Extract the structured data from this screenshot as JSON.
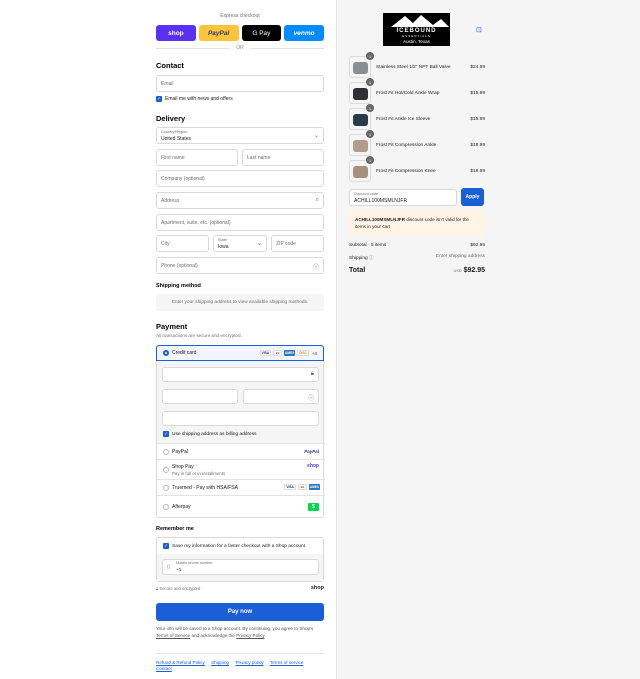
{
  "express": {
    "title": "Express checkout",
    "shop": "shop",
    "paypal": "PayPal",
    "gpay": "G Pay",
    "venmo": "venmo",
    "or": "OR"
  },
  "contact": {
    "heading": "Contact",
    "email_placeholder": "Email",
    "news_label": "Email me with news and offers"
  },
  "delivery": {
    "heading": "Delivery",
    "country_label": "Country/Region",
    "country_value": "United States",
    "first_name": "First name",
    "last_name": "Last name",
    "company": "Company (optional)",
    "address": "Address",
    "apartment": "Apartment, suite, etc. (optional)",
    "city": "City",
    "state_label": "State",
    "state_value": "Iowa",
    "zip": "ZIP code",
    "phone": "Phone (optional)"
  },
  "shipping_method": {
    "heading": "Shipping method",
    "note": "Enter your shipping address to view available shipping methods."
  },
  "payment": {
    "heading": "Payment",
    "subtitle": "All transactions are secure and encrypted.",
    "credit_card": "Credit card",
    "card_more": "+4",
    "billing_same": "Use shipping address as billing address",
    "paypal": "PayPal",
    "shoppay": "Shop Pay",
    "shoppay_sub": "Pay in full or in installments",
    "truemed": "Truemed - Pay with HSA/FSA",
    "afterpay": "Afterpay",
    "card_logos": [
      "VISA",
      "MC",
      "AMEX",
      "DISC"
    ]
  },
  "remember": {
    "heading": "Remember me",
    "save_info": "Save my information for a faster checkout with a Shop account",
    "mobile_label": "Mobile phone number",
    "mobile_value": "+1",
    "secure": "Secure and encrypted",
    "shop": "shop"
  },
  "pay_now": "Pay now",
  "legal": {
    "text1": "Your info will be saved to a Shop account. By continuing, you agree to Shop's ",
    "terms": "Terms of Service",
    "text2": " and acknowledge the ",
    "privacy": "Privacy Policy",
    "text3": "."
  },
  "footer": [
    "Refund & Refund Policy",
    "Shipping",
    "Privacy policy",
    "Terms of service",
    "Contact"
  ],
  "brand": {
    "name": "ICEBOUND",
    "sub": "ESSENTIALS",
    "location": "Austin, Texas"
  },
  "items": [
    {
      "name": "Stainless Steel 1/2\" NPT Ball Valve",
      "price": "$24.99",
      "qty": "1",
      "color": "#8a8f96"
    },
    {
      "name": "Frost Fit Hot/Cold Ankle Wrap",
      "price": "$15.99",
      "qty": "1",
      "color": "#2f2f33"
    },
    {
      "name": "Frost Fit Ankle Ice Sleeve",
      "price": "$15.99",
      "qty": "1",
      "color": "#2c3a48"
    },
    {
      "name": "Frost Fit Compression Ankle",
      "price": "$18.99",
      "qty": "1",
      "color": "#b49a8a"
    },
    {
      "name": "Frost Fit Compression Knee",
      "price": "$18.99",
      "qty": "1",
      "color": "#a89080"
    }
  ],
  "discount": {
    "label": "Discount code",
    "value": "ACHILL100MSMLNJFR",
    "apply": "Apply",
    "error_code": "ACHILL100MSMLNJFR",
    "error_text": " discount code isn't valid for the items in your cart"
  },
  "summary": {
    "subtotal_label": "Subtotal · 5 items",
    "subtotal": "$92.95",
    "shipping_label": "Shipping",
    "shipping_value": "Enter shipping address",
    "total_label": "Total",
    "currency": "USD",
    "total": "$92.95"
  },
  "colors": {
    "accent": "#1a5ed8",
    "shop": "#5a31f4",
    "paypal": "#ffc439",
    "venmo": "#008cff"
  }
}
